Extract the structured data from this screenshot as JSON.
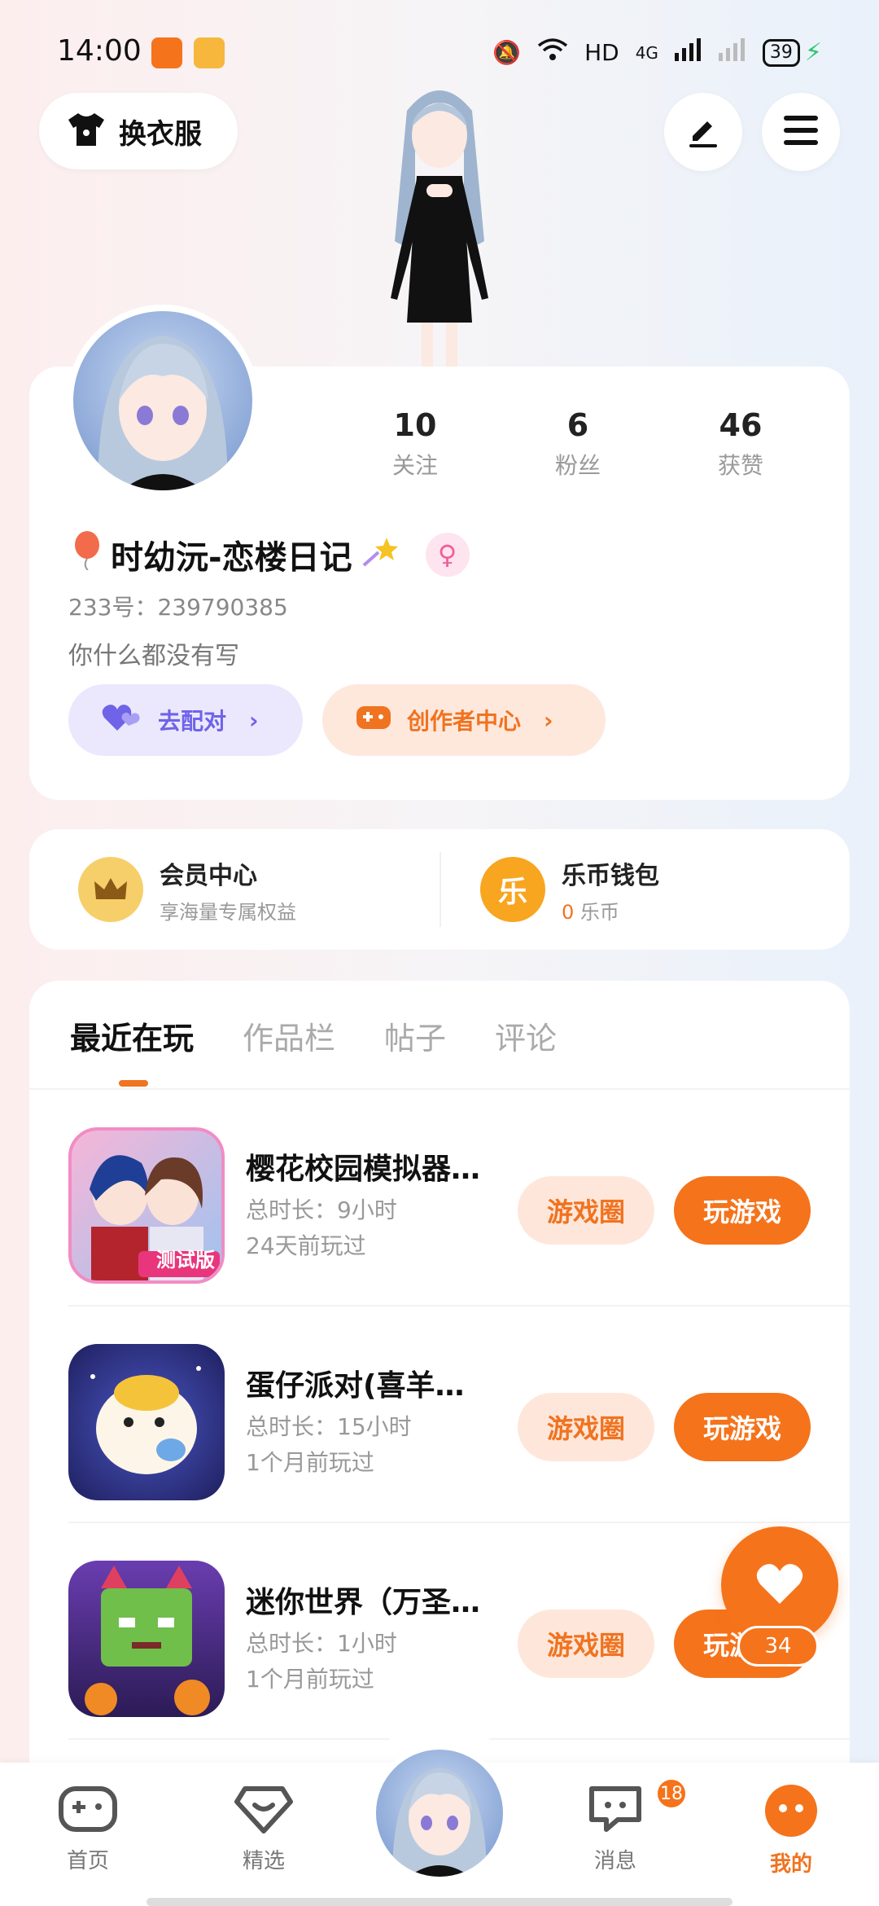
{
  "status_bar": {
    "time": "14:00",
    "network": "HD",
    "signal": "4G",
    "battery": "39"
  },
  "header": {
    "dress_label": "换衣服",
    "edit_icon": "pen-icon",
    "menu_icon": "menu-icon"
  },
  "profile": {
    "stats": [
      {
        "num": "10",
        "label": "关注"
      },
      {
        "num": "6",
        "label": "粉丝"
      },
      {
        "num": "46",
        "label": "获赞"
      }
    ],
    "nickname": "时幼沅-恋楼日记",
    "gender_symbol": "♀",
    "uid": "233号：239790385",
    "bio": "你什么都没有写",
    "match_label": "去配对",
    "creator_label": "创作者中心"
  },
  "vip": {
    "member_title": "会员中心",
    "member_sub": "享海量专属权益",
    "wallet_icon_char": "乐",
    "wallet_title": "乐币钱包",
    "wallet_amount": "0",
    "wallet_unit": "乐币"
  },
  "tabs": [
    "最近在玩",
    "作品栏",
    "帖子",
    "评论"
  ],
  "games": [
    {
      "name": "樱花校园模拟器…",
      "duration": "总时长：9小时",
      "last": "24天前玩过",
      "circle_label": "游戏圈",
      "play_label": "玩游戏",
      "tag": "测试版"
    },
    {
      "name": "蛋仔派对(喜羊…",
      "duration": "总时长：15小时",
      "last": "1个月前玩过",
      "circle_label": "游戏圈",
      "play_label": "玩游戏",
      "tag": ""
    },
    {
      "name": "迷你世界（万圣…",
      "duration": "总时长：1小时",
      "last": "1个月前玩过",
      "circle_label": "游戏圈",
      "play_label": "玩游戏",
      "tag": ""
    }
  ],
  "float_like_count": "34",
  "nav": {
    "home": "首页",
    "featured": "精选",
    "messages": "消息",
    "messages_badge": "18",
    "mine": "我的"
  },
  "colors": {
    "accent": "#f5731b",
    "purple": "#6f63e8"
  }
}
